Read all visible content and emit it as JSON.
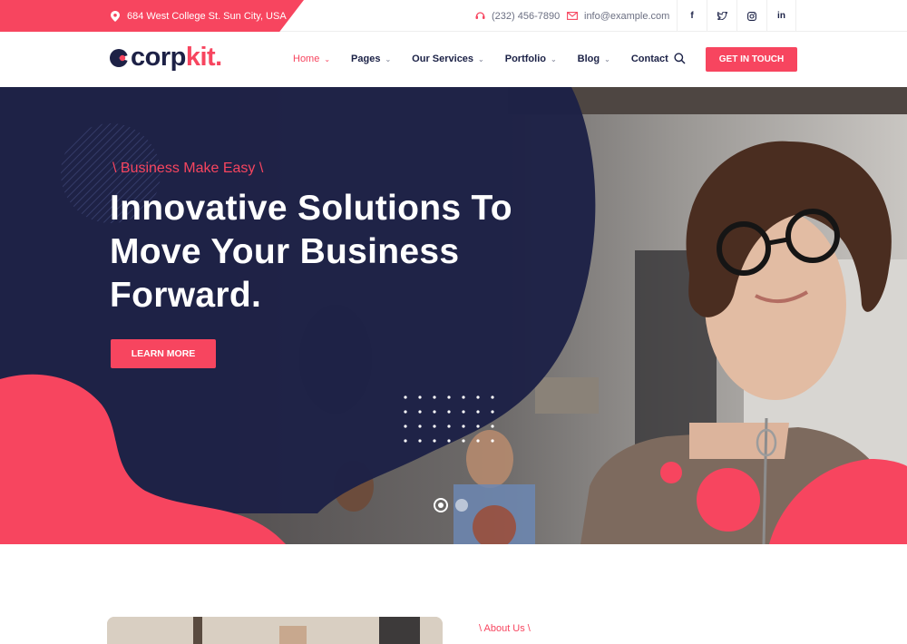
{
  "topbar": {
    "address": "684 West College St. Sun City, USA",
    "phone": "(232) 456-7890",
    "email": "info@example.com",
    "socials": [
      {
        "icon": "facebook-icon",
        "glyph": "f"
      },
      {
        "icon": "twitter-icon",
        "glyph": "t"
      },
      {
        "icon": "instagram-icon",
        "glyph": "◎"
      },
      {
        "icon": "linkedin-icon",
        "glyph": "in"
      }
    ]
  },
  "header": {
    "logo_corp": "corp",
    "logo_kit": "kit.",
    "nav": [
      {
        "label": "Home",
        "dropdown": true,
        "active": true
      },
      {
        "label": "Pages",
        "dropdown": true
      },
      {
        "label": "Our Services",
        "dropdown": true
      },
      {
        "label": "Portfolio",
        "dropdown": true
      },
      {
        "label": "Blog",
        "dropdown": true
      },
      {
        "label": "Contact",
        "dropdown": false
      }
    ],
    "cta_label": "GET IN TOUCH"
  },
  "hero": {
    "eyebrow": "\\ Business Make Easy \\",
    "headline": "Innovative Solutions To Move Your Business Forward.",
    "button_label": "LEARN MORE",
    "slides_total": 2,
    "active_slide": 1
  },
  "about": {
    "tag": "\\ About Us \\"
  },
  "colors": {
    "accent": "#f7455f",
    "navy": "#1d2146"
  }
}
